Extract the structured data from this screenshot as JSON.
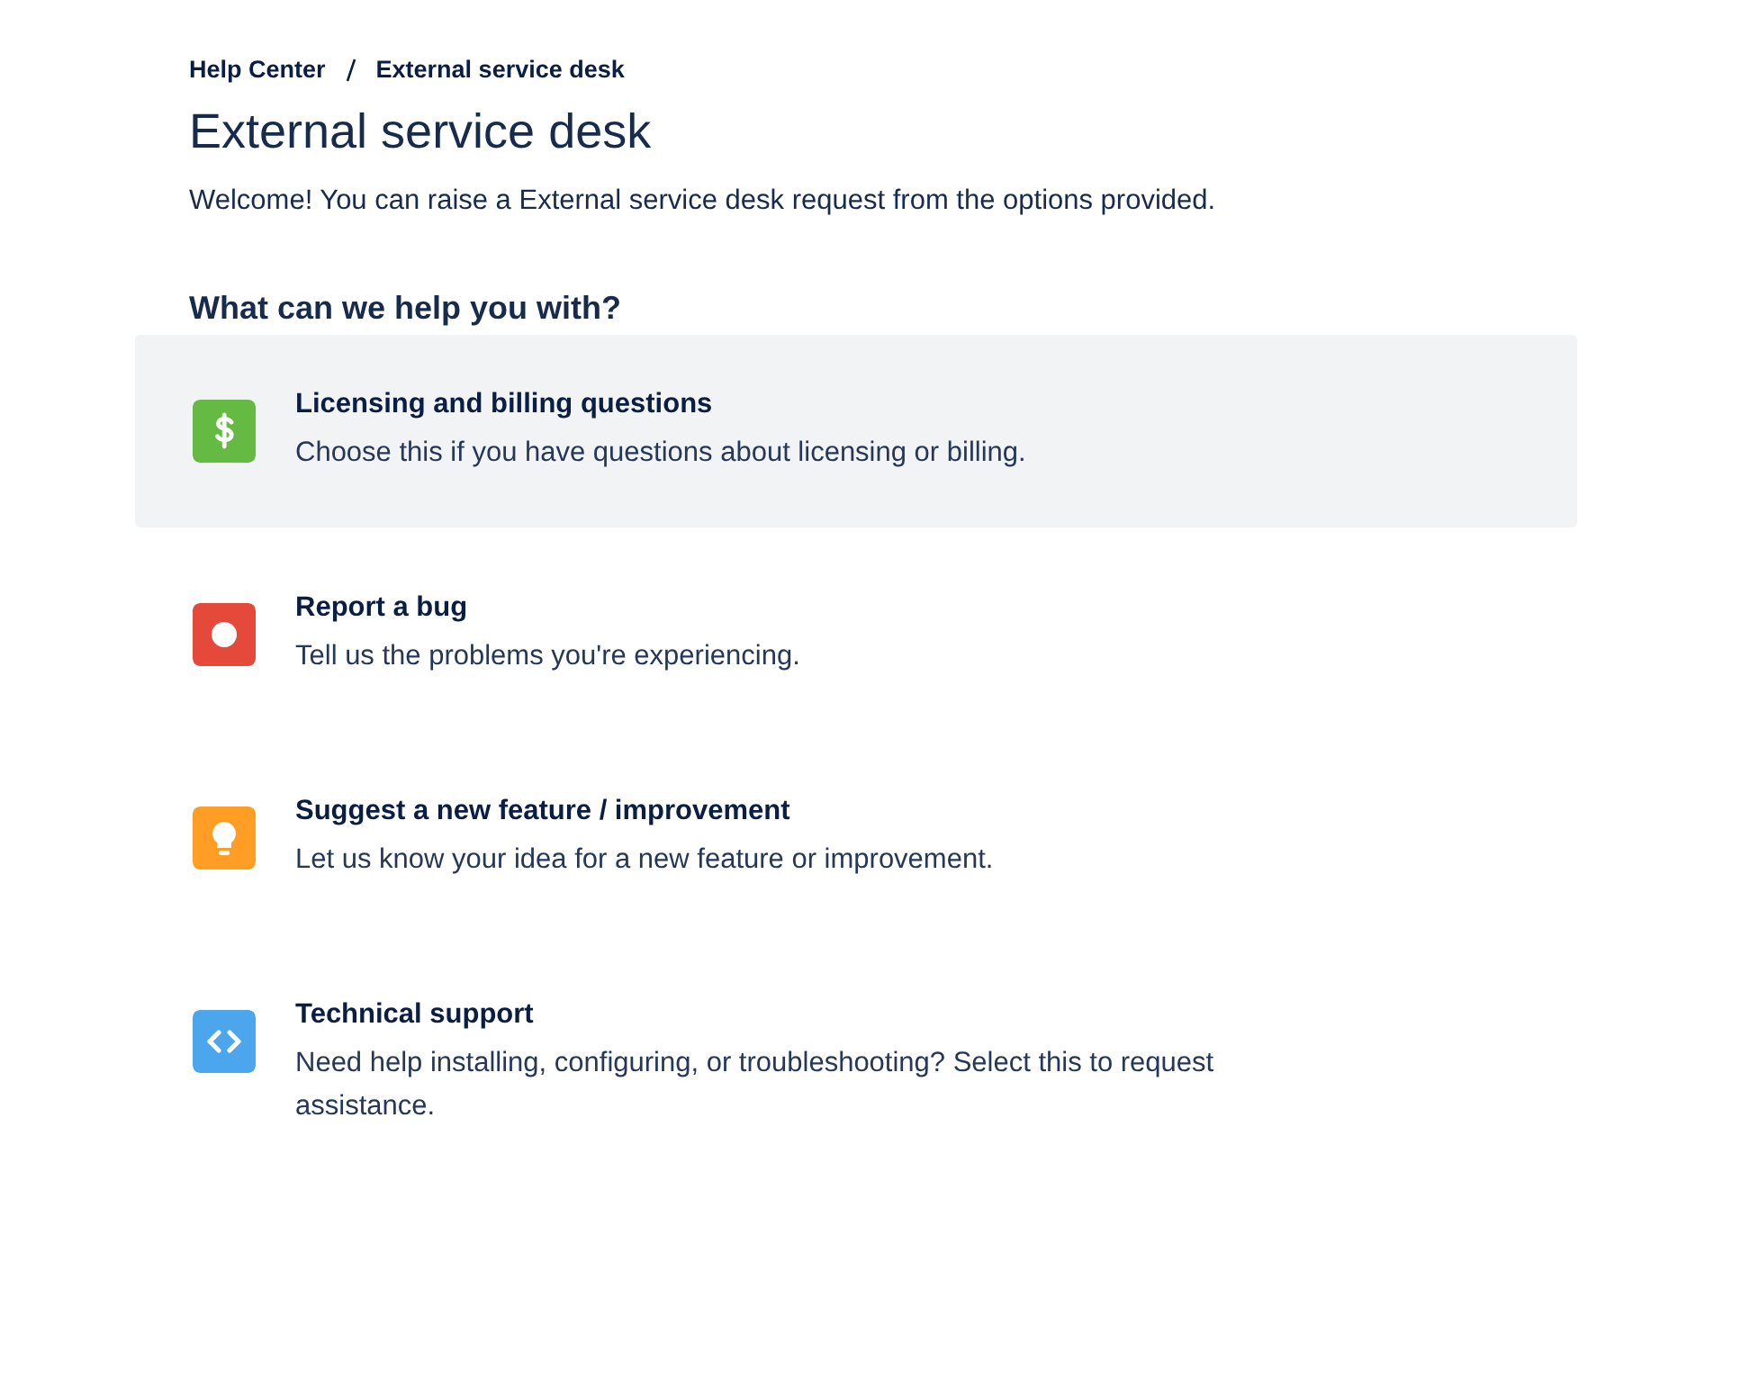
{
  "breadcrumbs": [
    "Help Center",
    "External service desk"
  ],
  "title": "External service desk",
  "welcome": "Welcome! You can raise a External service desk request from the options provided.",
  "section_heading": "What can we help you with?",
  "request_types": [
    {
      "kind": "dollar",
      "color": "#65ba43",
      "name": "Licensing and billing questions",
      "description": "Choose this if you have questions about licensing or billing.",
      "selected": true
    },
    {
      "kind": "record",
      "color": "#e5493a",
      "name": "Report a bug",
      "description": "Tell us the problems you're experiencing.",
      "selected": false
    },
    {
      "kind": "bulb",
      "color": "#ff9d24",
      "name": "Suggest a new feature / improvement",
      "description": "Let us know your idea for a new feature or improvement.",
      "selected": false
    },
    {
      "kind": "code",
      "color": "#4ba6ee",
      "name": "Technical support",
      "description": "Need help installing, configuring, or troubleshooting? Select this to request assistance.",
      "selected": false
    }
  ]
}
